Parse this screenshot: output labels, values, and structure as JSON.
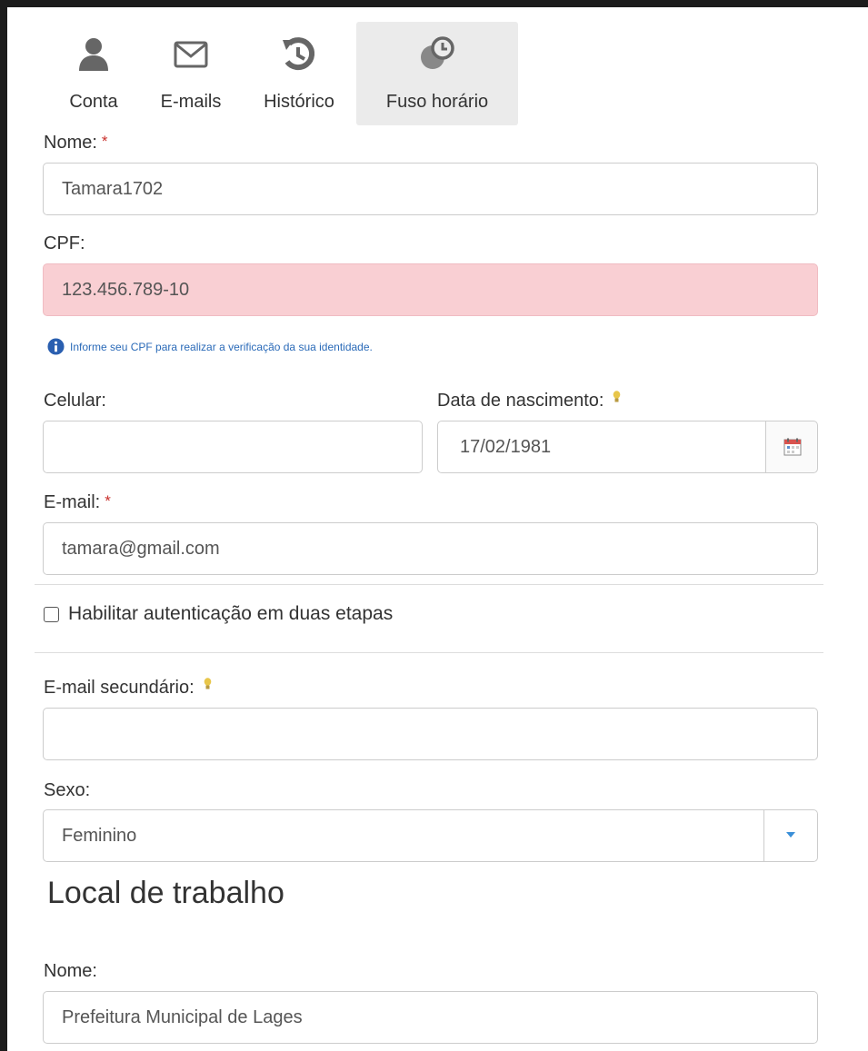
{
  "tabs": [
    {
      "label": "Conta",
      "icon": "user-icon"
    },
    {
      "label": "E-mails",
      "icon": "envelope-icon"
    },
    {
      "label": "Histórico",
      "icon": "history-icon"
    },
    {
      "label": "Fuso horário",
      "icon": "timezone-icon",
      "active": true
    }
  ],
  "form": {
    "nome": {
      "label": "Nome:",
      "required_mark": "*",
      "value": "Tamara1702"
    },
    "cpf": {
      "label": "CPF:",
      "value": "123.456.789-10",
      "help": "Informe seu CPF para realizar a verificação da sua identidade."
    },
    "celular": {
      "label": "Celular:",
      "value": ""
    },
    "data_nascimento": {
      "label": "Data de nascimento:",
      "value": "17/02/1981"
    },
    "email": {
      "label": "E-mail:",
      "required_mark": "*",
      "value": "tamara@gmail.com"
    },
    "two_factor": {
      "label": "Habilitar autenticação em duas etapas",
      "checked": false
    },
    "email_secundario": {
      "label": "E-mail secundário:",
      "value": ""
    },
    "sexo": {
      "label": "Sexo:",
      "value": "Feminino"
    }
  },
  "local_trabalho": {
    "heading": "Local de trabalho",
    "nome": {
      "label": "Nome:",
      "value": "Prefeitura Municipal de Lages"
    }
  },
  "colors": {
    "error_bg": "#f9cfd3",
    "required": "#c9302c",
    "help_text": "#2a6ab8",
    "active_tab_bg": "#ebebeb"
  }
}
